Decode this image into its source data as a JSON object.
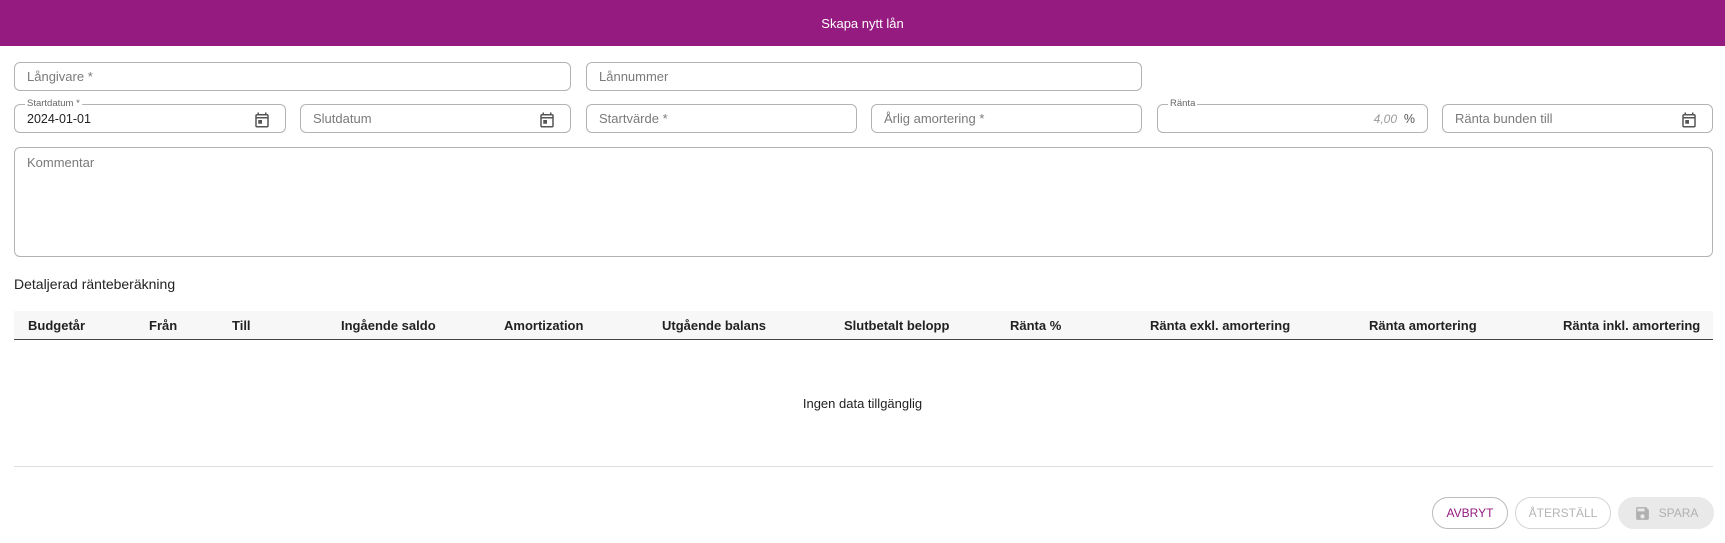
{
  "dialog": {
    "title": "Skapa nytt lån"
  },
  "form": {
    "lender": {
      "placeholder": "Långivare *"
    },
    "loan_number": {
      "placeholder": "Lånnummer"
    },
    "start_date": {
      "label": "Startdatum *",
      "value": "2024-01-01"
    },
    "end_date": {
      "placeholder": "Slutdatum"
    },
    "start_value": {
      "placeholder": "Startvärde *"
    },
    "annual_amortization": {
      "placeholder": "Årlig amortering *"
    },
    "interest": {
      "label": "Ränta",
      "value": "4,00",
      "unit": "%"
    },
    "interest_fixed_until": {
      "placeholder": "Ränta bunden till"
    },
    "comment": {
      "placeholder": "Kommentar"
    }
  },
  "table": {
    "title": "Detaljerad ränteberäkning",
    "columns": [
      "Budgetår",
      "Från",
      "Till",
      "Ingående saldo",
      "Amortization",
      "Utgående balans",
      "Slutbetalt belopp",
      "Ränta %",
      "Ränta exkl. amortering",
      "Ränta amortering",
      "Ränta inkl. amortering"
    ],
    "empty_text": "Ingen data tillgänglig"
  },
  "actions": {
    "cancel": "AVBRYT",
    "reset": "ÅTERSTÄLL",
    "save": "SPARA"
  },
  "colors": {
    "brand": "#951b81"
  }
}
